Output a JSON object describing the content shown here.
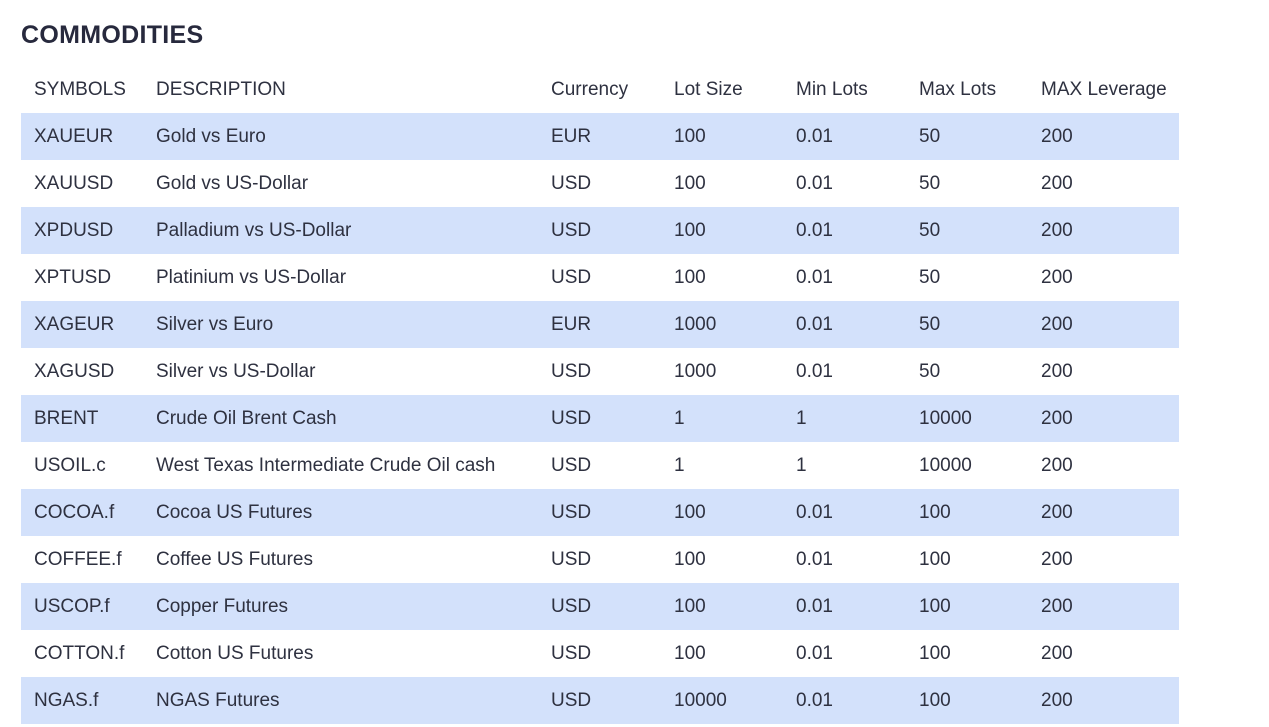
{
  "page": {
    "title": "COMMODITIES"
  },
  "table": {
    "headers": [
      "SYMBOLS",
      "DESCRIPTION",
      "Currency",
      "Lot Size",
      "Min Lots",
      "Max Lots",
      "MAX Leverage"
    ],
    "rows": [
      [
        "XAUEUR",
        "Gold vs Euro",
        "EUR",
        "100",
        "0.01",
        "50",
        "200"
      ],
      [
        "XAUUSD",
        "Gold vs US-Dollar",
        "USD",
        "100",
        "0.01",
        "50",
        "200"
      ],
      [
        "XPDUSD",
        "Palladium vs US-Dollar",
        "USD",
        "100",
        "0.01",
        "50",
        "200"
      ],
      [
        "XPTUSD",
        "Platinium vs US-Dollar",
        "USD",
        "100",
        "0.01",
        "50",
        "200"
      ],
      [
        "XAGEUR",
        "Silver vs Euro",
        "EUR",
        "1000",
        "0.01",
        "50",
        "200"
      ],
      [
        "XAGUSD",
        "Silver vs US-Dollar",
        "USD",
        "1000",
        "0.01",
        "50",
        "200"
      ],
      [
        "BRENT",
        "Crude Oil Brent Cash",
        "USD",
        "1",
        "1",
        "10000",
        "200"
      ],
      [
        "USOIL.c",
        "West Texas Intermediate Crude Oil cash",
        "USD",
        "1",
        "1",
        "10000",
        "200"
      ],
      [
        "COCOA.f",
        "Cocoa US Futures",
        "USD",
        "100",
        "0.01",
        "100",
        "200"
      ],
      [
        "COFFEE.f",
        "Coffee US Futures",
        "USD",
        "100",
        "0.01",
        "100",
        "200"
      ],
      [
        "USCOP.f",
        "Copper Futures",
        "USD",
        "100",
        "0.01",
        "100",
        "200"
      ],
      [
        "COTTON.f",
        "Cotton US Futures",
        "USD",
        "100",
        "0.01",
        "100",
        "200"
      ],
      [
        "NGAS.f",
        "NGAS Futures",
        "USD",
        "10000",
        "0.01",
        "100",
        "200"
      ]
    ]
  },
  "colors": {
    "row_stripe": "#d3e1fb",
    "row_plain": "#ffffff",
    "title_text": "#27293d",
    "body_text": "#2e3140"
  }
}
